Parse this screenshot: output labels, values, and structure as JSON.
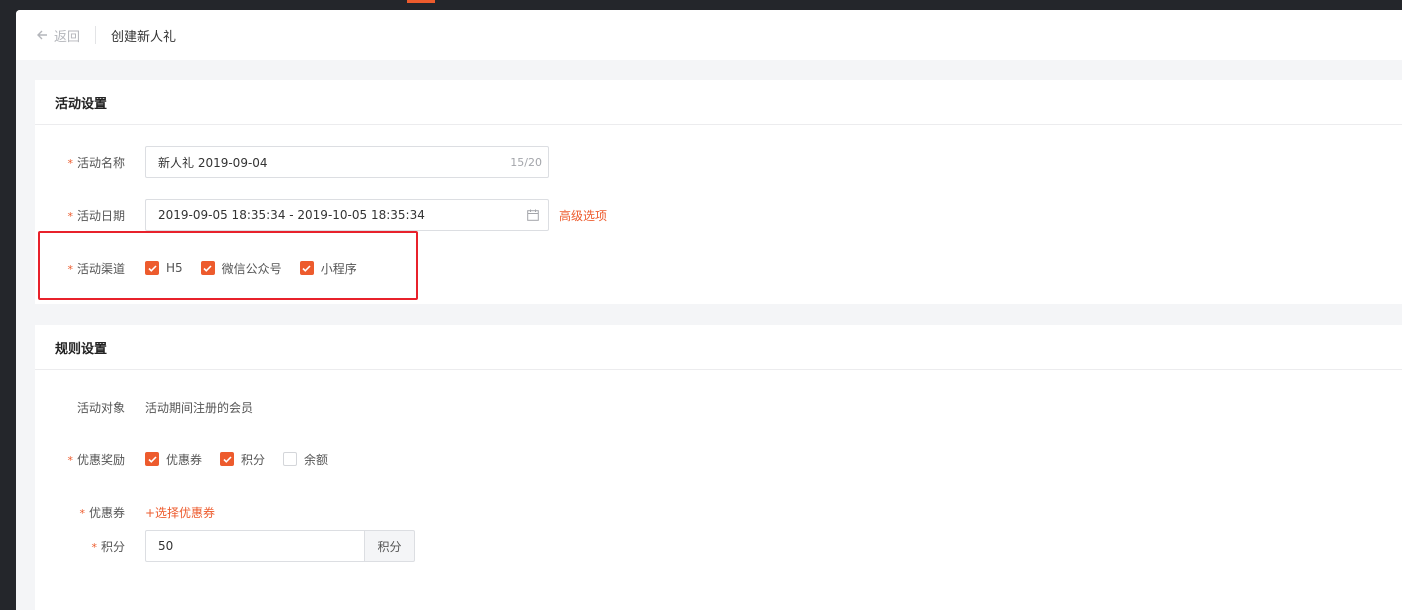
{
  "header": {
    "back_label": "返回",
    "title": "创建新人礼"
  },
  "activity_settings": {
    "section_title": "活动设置",
    "name": {
      "label": "活动名称",
      "value": "新人礼  2019-09-04",
      "counter": "15/20"
    },
    "date": {
      "label": "活动日期",
      "value": "2019-09-05 18:35:34 - 2019-10-05 18:35:34",
      "advanced_link": "高级选项"
    },
    "channel": {
      "label": "活动渠道",
      "options": [
        {
          "label": "H5",
          "checked": true
        },
        {
          "label": "微信公众号",
          "checked": true
        },
        {
          "label": "小程序",
          "checked": true
        }
      ]
    }
  },
  "rule_settings": {
    "section_title": "规则设置",
    "target": {
      "label": "活动对象",
      "value": "活动期间注册的会员"
    },
    "reward": {
      "label": "优惠奖励",
      "options": [
        {
          "label": "优惠券",
          "checked": true
        },
        {
          "label": "积分",
          "checked": true
        },
        {
          "label": "余额",
          "checked": false
        }
      ]
    },
    "coupon": {
      "label": "优惠券",
      "add_link": "+选择优惠券"
    },
    "points": {
      "label": "积分",
      "value": "50",
      "unit": "积分"
    }
  },
  "required_mark": "*",
  "colors": {
    "accent": "#ed5b2d",
    "highlight": "#e8212b"
  }
}
